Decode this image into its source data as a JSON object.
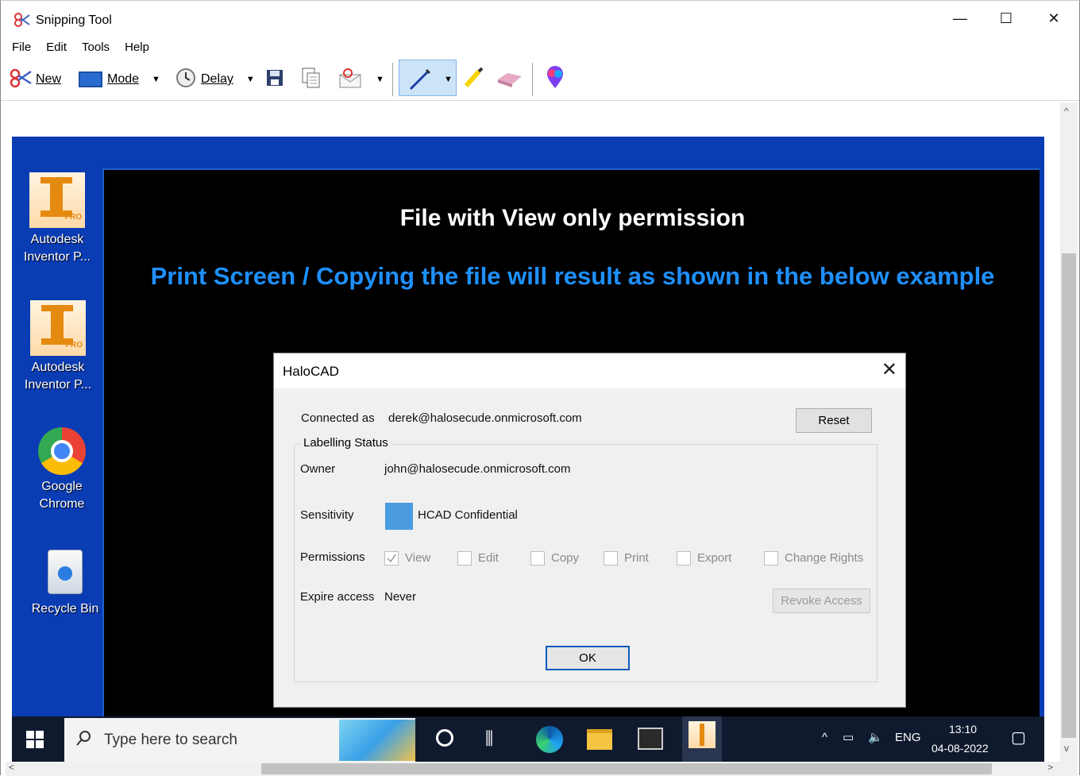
{
  "window": {
    "title": "Snipping Tool",
    "controls": {
      "minimize": "—",
      "maximize": "☐",
      "close": "✕"
    }
  },
  "menu": [
    "File",
    "Edit",
    "Tools",
    "Help"
  ],
  "toolbar": {
    "new_label": "New",
    "mode_label": "Mode",
    "delay_label": "Delay"
  },
  "desktop": {
    "heading": "File with View only permission",
    "subheading": "Print Screen / Copying the file will result as shown in the below example",
    "icons": [
      {
        "line1": "Autodesk",
        "line2": "Inventor P..."
      },
      {
        "line1": "Autodesk",
        "line2": "Inventor P..."
      },
      {
        "line1": "Google",
        "line2": "Chrome"
      },
      {
        "line1": "Recycle Bin",
        "line2": ""
      }
    ],
    "icon_badge": "PRO"
  },
  "dialog": {
    "title": "HaloCAD",
    "connected_label": "Connected as",
    "connected_value": "derek@halosecude.onmicrosoft.com",
    "reset_button": "Reset",
    "group_label": "Labelling Status",
    "owner_label": "Owner",
    "owner_value": "john@halosecude.onmicrosoft.com",
    "sensitivity_label": "Sensitivity",
    "sensitivity_value": "HCAD Confidential",
    "sensitivity_color": "#4b9be0",
    "permissions_label": "Permissions",
    "permissions": [
      {
        "label": "View",
        "checked": true
      },
      {
        "label": "Edit",
        "checked": false
      },
      {
        "label": "Copy",
        "checked": false
      },
      {
        "label": "Print",
        "checked": false
      },
      {
        "label": "Export",
        "checked": false
      },
      {
        "label": "Change Rights",
        "checked": false
      }
    ],
    "expire_label": "Expire access",
    "expire_value": "Never",
    "revoke_button": "Revoke Access",
    "ok_button": "OK"
  },
  "taskbar": {
    "search_placeholder": "Type here to search",
    "language": "ENG",
    "time": "13:10",
    "date": "04-08-2022"
  }
}
